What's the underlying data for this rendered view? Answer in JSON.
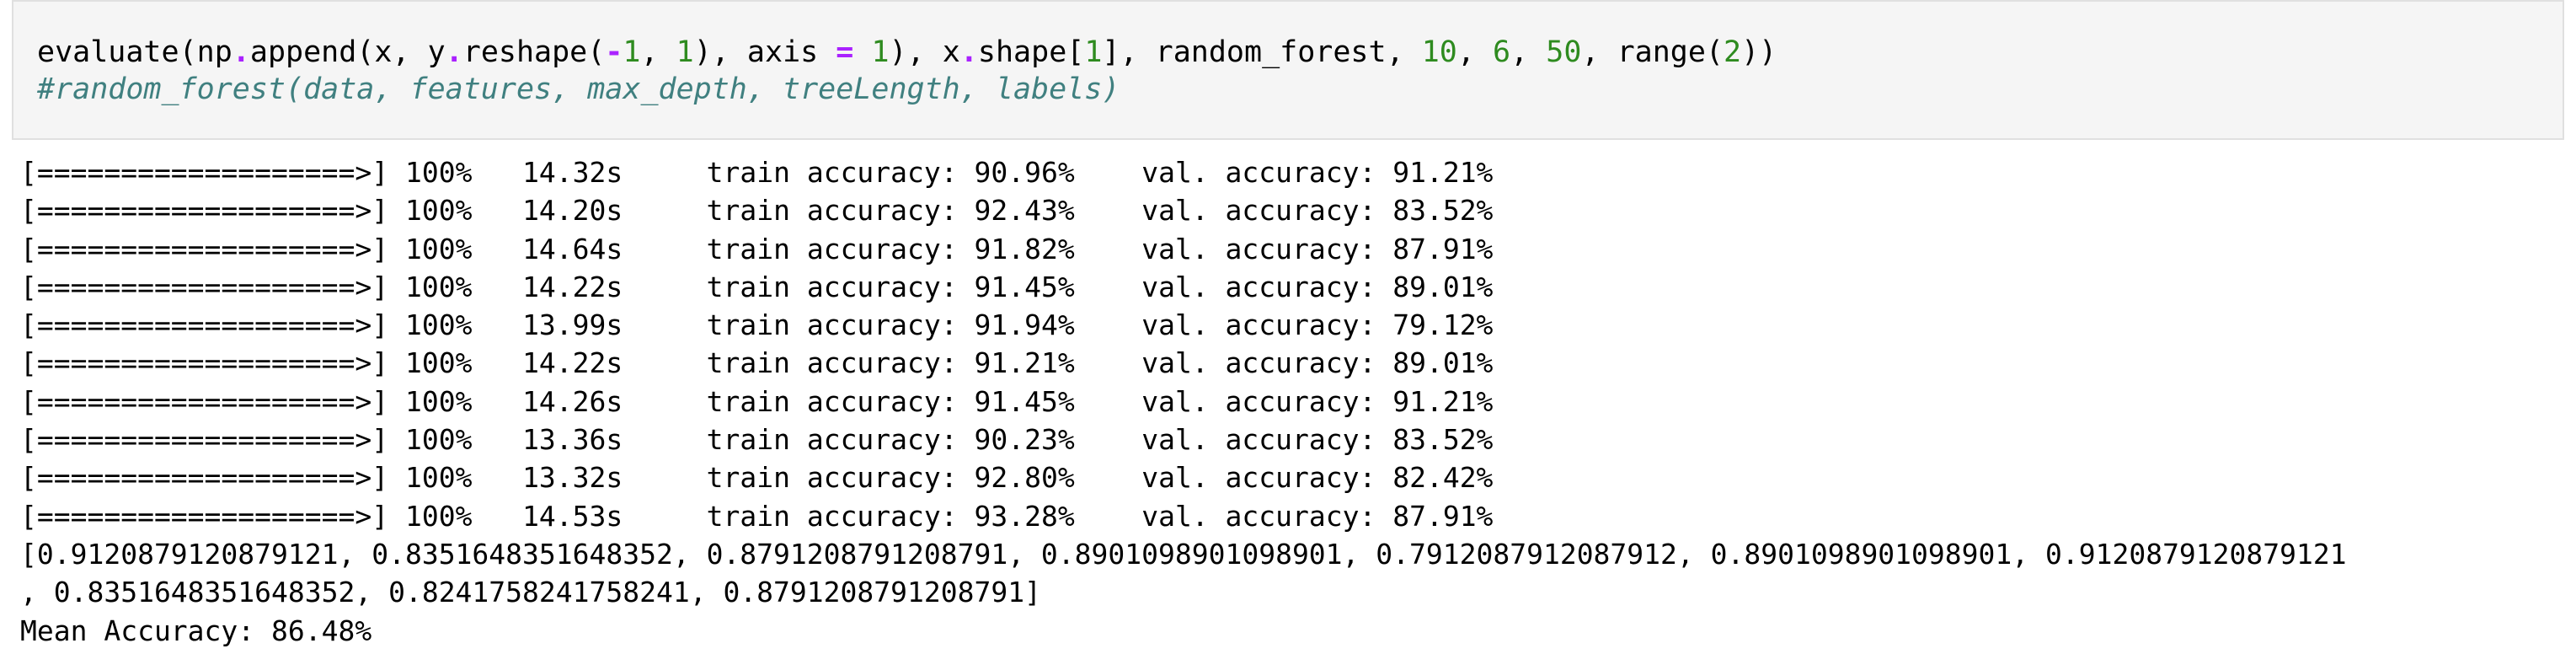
{
  "code_cell": {
    "line1": [
      {
        "t": "evaluate(np",
        "c": "plain"
      },
      {
        "t": ".",
        "c": "op"
      },
      {
        "t": "append(x, y",
        "c": "plain"
      },
      {
        "t": ".",
        "c": "op"
      },
      {
        "t": "reshape(",
        "c": "plain"
      },
      {
        "t": "-",
        "c": "op"
      },
      {
        "t": "1",
        "c": "num"
      },
      {
        "t": ", ",
        "c": "plain"
      },
      {
        "t": "1",
        "c": "num"
      },
      {
        "t": "), axis ",
        "c": "plain"
      },
      {
        "t": "=",
        "c": "op"
      },
      {
        "t": " ",
        "c": "plain"
      },
      {
        "t": "1",
        "c": "num"
      },
      {
        "t": "), x",
        "c": "plain"
      },
      {
        "t": ".",
        "c": "op"
      },
      {
        "t": "shape[",
        "c": "plain"
      },
      {
        "t": "1",
        "c": "num"
      },
      {
        "t": "], random_forest, ",
        "c": "plain"
      },
      {
        "t": "10",
        "c": "num"
      },
      {
        "t": ", ",
        "c": "plain"
      },
      {
        "t": "6",
        "c": "num"
      },
      {
        "t": ", ",
        "c": "plain"
      },
      {
        "t": "50",
        "c": "num"
      },
      {
        "t": ", range(",
        "c": "plain"
      },
      {
        "t": "2",
        "c": "num"
      },
      {
        "t": "))",
        "c": "plain"
      }
    ],
    "line2": "#random_forest(data, features, max_depth, treeLength, labels)"
  },
  "output": {
    "runs": [
      {
        "bar": "[===================>]",
        "pct": "100%",
        "time": "14.32s",
        "train": "train accuracy: 90.96%",
        "val": "val. accuracy: 91.21%"
      },
      {
        "bar": "[===================>]",
        "pct": "100%",
        "time": "14.20s",
        "train": "train accuracy: 92.43%",
        "val": "val. accuracy: 83.52%"
      },
      {
        "bar": "[===================>]",
        "pct": "100%",
        "time": "14.64s",
        "train": "train accuracy: 91.82%",
        "val": "val. accuracy: 87.91%"
      },
      {
        "bar": "[===================>]",
        "pct": "100%",
        "time": "14.22s",
        "train": "train accuracy: 91.45%",
        "val": "val. accuracy: 89.01%"
      },
      {
        "bar": "[===================>]",
        "pct": "100%",
        "time": "13.99s",
        "train": "train accuracy: 91.94%",
        "val": "val. accuracy: 79.12%"
      },
      {
        "bar": "[===================>]",
        "pct": "100%",
        "time": "14.22s",
        "train": "train accuracy: 91.21%",
        "val": "val. accuracy: 89.01%"
      },
      {
        "bar": "[===================>]",
        "pct": "100%",
        "time": "14.26s",
        "train": "train accuracy: 91.45%",
        "val": "val. accuracy: 91.21%"
      },
      {
        "bar": "[===================>]",
        "pct": "100%",
        "time": "13.36s",
        "train": "train accuracy: 90.23%",
        "val": "val. accuracy: 83.52%"
      },
      {
        "bar": "[===================>]",
        "pct": "100%",
        "time": "13.32s",
        "train": "train accuracy: 92.80%",
        "val": "val. accuracy: 82.42%"
      },
      {
        "bar": "[===================>]",
        "pct": "100%",
        "time": "14.53s",
        "train": "train accuracy: 93.28%",
        "val": "val. accuracy: 87.91%"
      }
    ],
    "list_line1": "[0.9120879120879121, 0.8351648351648352, 0.8791208791208791, 0.8901098901098901, 0.7912087912087912, 0.8901098901098901, 0.9120879120879121",
    "list_line2": ", 0.8351648351648352, 0.8241758241758241, 0.8791208791208791]",
    "mean": "Mean Accuracy: 86.48%"
  },
  "colors": {
    "operator": "#aa22ff",
    "number": "#2e8b1f",
    "comment": "#408080",
    "cell_background": "#f5f5f5",
    "cell_border": "#e0e0e0"
  }
}
